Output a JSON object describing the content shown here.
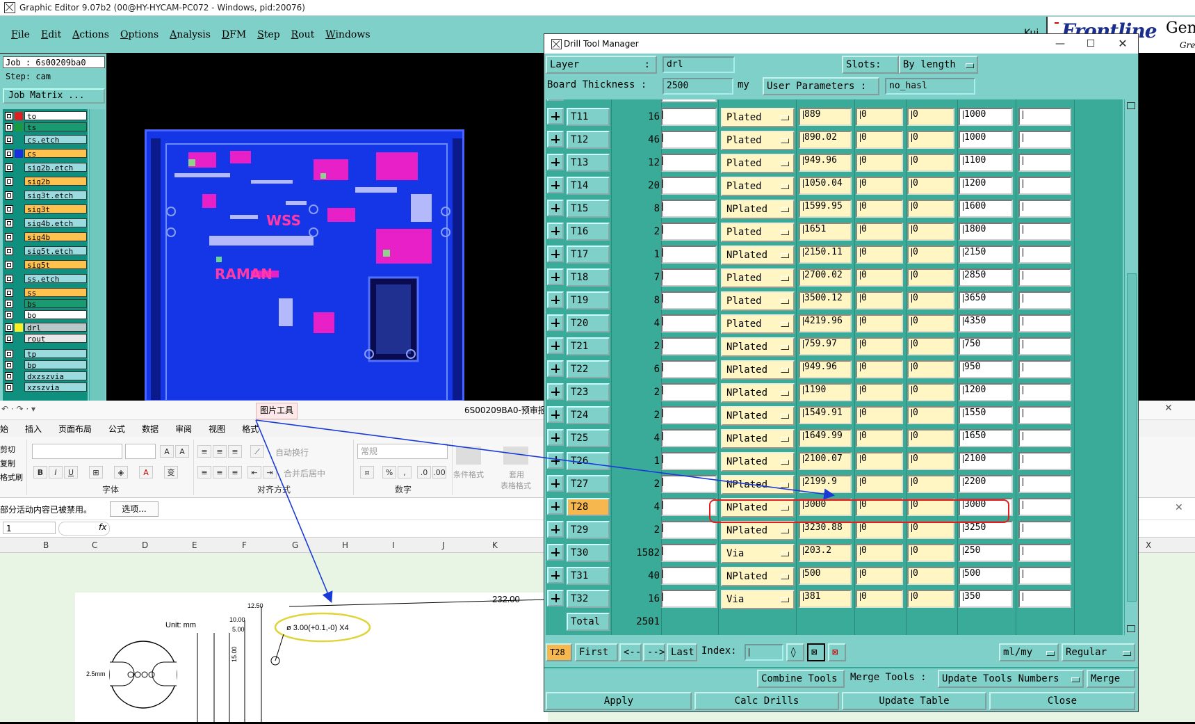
{
  "main_window": {
    "title": "Graphic Editor 9.07b2 (00@HY-HYCAM-PC072 - Windows, pid:20076)",
    "menu": [
      "File",
      "Edit",
      "Actions",
      "Options",
      "Analysis",
      "DFM",
      "Step",
      "Rout",
      "Windows"
    ],
    "brand": {
      "name": "Frontline",
      "suffix": "Gen",
      "tag": "Gre",
      "misc": "Kui"
    }
  },
  "left_panel": {
    "job": "Job : 6s00209ba0",
    "step": "Step: cam",
    "job_matrix": "Job Matrix ...",
    "layers": [
      {
        "name": "to",
        "color": "#e02020",
        "bg": "#ffffff"
      },
      {
        "name": "ts",
        "color": "#1a9a40",
        "bg": "#1a9a70"
      },
      {
        "name": "cs.etch",
        "color": "",
        "bg": "#9adbe0"
      },
      {
        "name": "cs",
        "color": "#1a2de0",
        "bg": "#ffc24e"
      },
      {
        "name": "sig2b.etch",
        "color": "",
        "bg": "#9adbe0"
      },
      {
        "name": "sig2b",
        "color": "",
        "bg": "#ffc24e"
      },
      {
        "name": "sig3t.etch",
        "color": "",
        "bg": "#9adbe0"
      },
      {
        "name": "sig3t",
        "color": "",
        "bg": "#ffc24e"
      },
      {
        "name": "sig4b.etch",
        "color": "",
        "bg": "#9adbe0"
      },
      {
        "name": "sig4b",
        "color": "",
        "bg": "#ffc24e"
      },
      {
        "name": "sig5t.etch",
        "color": "",
        "bg": "#9adbe0"
      },
      {
        "name": "sig5t",
        "color": "",
        "bg": "#ffc24e"
      },
      {
        "name": "ss.etch",
        "color": "",
        "bg": "#9adbe0"
      },
      {
        "name": "ss",
        "color": "",
        "bg": "#ffc24e"
      },
      {
        "name": "bs",
        "color": "",
        "bg": "#1a9a70"
      },
      {
        "name": "bo",
        "color": "",
        "bg": "#ffffff"
      },
      {
        "name": "drl",
        "color": "#ffee22",
        "bg": "#b8c8c8"
      },
      {
        "name": "rout",
        "color": "",
        "bg": "#e8e8e8"
      },
      {
        "name": "tp",
        "color": "",
        "bg": "#9adbe0"
      },
      {
        "name": "bp",
        "color": "",
        "bg": "#9adbe0"
      },
      {
        "name": "dxzszvia",
        "color": "",
        "bg": "#9adbe0"
      },
      {
        "name": "xzszvia",
        "color": "",
        "bg": "#9adbe0"
      }
    ]
  },
  "pcb": {
    "label1": "WSS",
    "label2": "RAMAN"
  },
  "excel": {
    "context_tab": "图片工具",
    "filename": "6S00209BA0-预审报",
    "tabs": [
      "始",
      "插入",
      "页面布局",
      "公式",
      "数据",
      "审阅",
      "视图",
      "格式"
    ],
    "clipboard": [
      "剪切",
      "复制",
      "格式刷"
    ],
    "groups": [
      "字体",
      "对齐方式",
      "数字"
    ],
    "wrap": "自动换行",
    "merge": "合并后居中",
    "number_format": "常规",
    "cond_format": "条件格式",
    "table_format": [
      "套用",
      "表格格式"
    ],
    "message": "部分活动内容已被禁用。",
    "options_btn": "选项...",
    "namebox": "1",
    "fx": "fx",
    "columns": [
      "B",
      "C",
      "D",
      "E",
      "F",
      "G",
      "H",
      "I",
      "J",
      "K",
      "X"
    ],
    "drawing": {
      "unit": "Unit: mm",
      "dim1": "232.00",
      "dim2": "12.50",
      "dim3": "10.00",
      "dim4": "5.00",
      "dim5": "15.00",
      "dim6": "2.5mm",
      "callout": "ø 3.00(+0.1,-0)  X4"
    }
  },
  "dtm": {
    "title": "Drill Tool Manager",
    "layer_label": "Layer",
    "layer_colon": ":",
    "layer_value": "drl",
    "slots_label": "Slots:",
    "slots_value": "By length",
    "thickness_label": "Board Thickness :",
    "thickness_value": "2500",
    "thickness_unit": "my",
    "user_params_label": "User Parameters :",
    "user_params_value": "no_hasl",
    "rows": [
      {
        "tool": "T11",
        "count": "16",
        "type": "Plated",
        "a": "889",
        "b": "0",
        "c": "0",
        "d": "1000"
      },
      {
        "tool": "T12",
        "count": "46",
        "type": "Plated",
        "a": "890.02",
        "b": "0",
        "c": "0",
        "d": "1000"
      },
      {
        "tool": "T13",
        "count": "12",
        "type": "Plated",
        "a": "949.96",
        "b": "0",
        "c": "0",
        "d": "1100"
      },
      {
        "tool": "T14",
        "count": "20",
        "type": "Plated",
        "a": "1050.04",
        "b": "0",
        "c": "0",
        "d": "1200"
      },
      {
        "tool": "T15",
        "count": "8",
        "type": "NPlated",
        "a": "1599.95",
        "b": "0",
        "c": "0",
        "d": "1600"
      },
      {
        "tool": "T16",
        "count": "2",
        "type": "Plated",
        "a": "1651",
        "b": "0",
        "c": "0",
        "d": "1800"
      },
      {
        "tool": "T17",
        "count": "1",
        "type": "NPlated",
        "a": "2150.11",
        "b": "0",
        "c": "0",
        "d": "2150"
      },
      {
        "tool": "T18",
        "count": "7",
        "type": "Plated",
        "a": "2700.02",
        "b": "0",
        "c": "0",
        "d": "2850"
      },
      {
        "tool": "T19",
        "count": "8",
        "type": "Plated",
        "a": "3500.12",
        "b": "0",
        "c": "0",
        "d": "3650"
      },
      {
        "tool": "T20",
        "count": "4",
        "type": "Plated",
        "a": "4219.96",
        "b": "0",
        "c": "0",
        "d": "4350"
      },
      {
        "tool": "T21",
        "count": "2",
        "type": "NPlated",
        "a": "759.97",
        "b": "0",
        "c": "0",
        "d": "750"
      },
      {
        "tool": "T22",
        "count": "6",
        "type": "NPlated",
        "a": "949.96",
        "b": "0",
        "c": "0",
        "d": "950"
      },
      {
        "tool": "T23",
        "count": "2",
        "type": "NPlated",
        "a": "1190",
        "b": "0",
        "c": "0",
        "d": "1200"
      },
      {
        "tool": "T24",
        "count": "2",
        "type": "NPlated",
        "a": "1549.91",
        "b": "0",
        "c": "0",
        "d": "1550"
      },
      {
        "tool": "T25",
        "count": "4",
        "type": "NPlated",
        "a": "1649.99",
        "b": "0",
        "c": "0",
        "d": "1650"
      },
      {
        "tool": "T26",
        "count": "1",
        "type": "NPlated",
        "a": "2100.07",
        "b": "0",
        "c": "0",
        "d": "2100"
      },
      {
        "tool": "T27",
        "count": "2",
        "type": "NPlated",
        "a": "2199.9",
        "b": "0",
        "c": "0",
        "d": "2200"
      },
      {
        "tool": "T28",
        "count": "4",
        "type": "NPlated",
        "a": "3000",
        "b": "0",
        "c": "0",
        "d": "3000",
        "selected": true
      },
      {
        "tool": "T29",
        "count": "2",
        "type": "NPlated",
        "a": "3230.88",
        "b": "0",
        "c": "0",
        "d": "3250"
      },
      {
        "tool": "T30",
        "count": "1582",
        "type": "Via",
        "a": "203.2",
        "b": "0",
        "c": "0",
        "d": "250"
      },
      {
        "tool": "T31",
        "count": "40",
        "type": "NPlated",
        "a": "500",
        "b": "0",
        "c": "0",
        "d": "500"
      },
      {
        "tool": "T32",
        "count": "16",
        "type": "Via",
        "a": "381",
        "b": "0",
        "c": "0",
        "d": "350"
      }
    ],
    "total_label": "Total",
    "total_value": "2501",
    "current_tool": "T28",
    "nav": {
      "first": "First",
      "prev": "<--",
      "next": "-->",
      "last": "Last",
      "index": "Index:"
    },
    "units": "ml/my",
    "mode": "Regular",
    "combine": "Combine Tools",
    "merge_label": "Merge Tools :",
    "update_numbers": "Update Tools Numbers",
    "merge": "Merge",
    "apply": "Apply",
    "calc": "Calc Drills",
    "update_table": "Update Table",
    "close": "Close"
  }
}
